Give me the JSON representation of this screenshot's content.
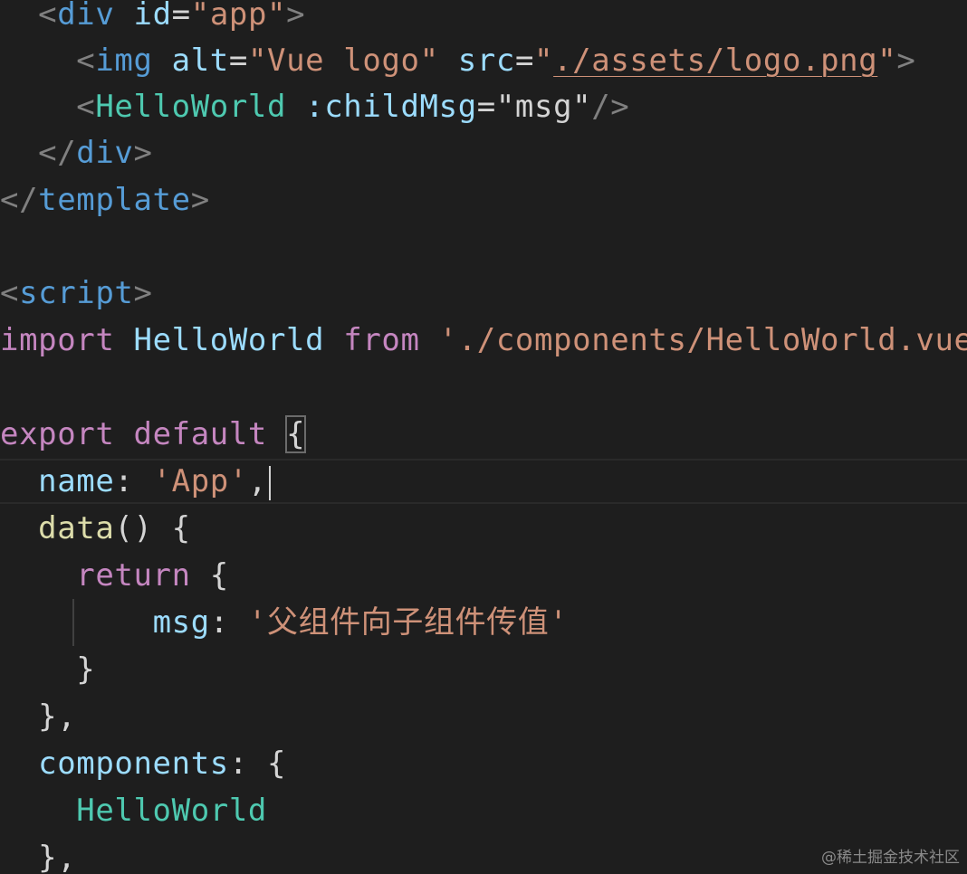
{
  "code": {
    "l1": {
      "lt": "<",
      "tag": "div",
      "attr": "id",
      "eq": "=",
      "q1": "\"",
      "val": "app",
      "q2": "\"",
      "gt": ">"
    },
    "l2": {
      "lt": "<",
      "tag": "img",
      "attr1": "alt",
      "eq1": "=",
      "val1": "\"Vue logo\"",
      "attr2": "src",
      "eq2": "=",
      "q1": "\"",
      "val2": "./assets/logo.png",
      "q2": "\"",
      "gt": ">"
    },
    "l3": {
      "lt": "<",
      "tag": "HelloWorld",
      "attr": ":childMsg",
      "eq": "=",
      "val": "\"msg\"",
      "close": "/>"
    },
    "l4": {
      "lt": "</",
      "tag": "div",
      "gt": ">"
    },
    "l5": {
      "lt": "</",
      "tag": "template",
      "gt": ">"
    },
    "l7": {
      "lt": "<",
      "tag": "script",
      "gt": ">"
    },
    "l8": {
      "kw1": "import",
      "ident": "HelloWorld",
      "kw2": "from",
      "str": "'./components/HelloWorld.vue'"
    },
    "l10": {
      "kw1": "export",
      "kw2": "default",
      "brace": "{"
    },
    "l11": {
      "key": "name",
      "colon": ":",
      "str": "'App'",
      "comma": ","
    },
    "l12": {
      "fn": "data",
      "rest": "() {"
    },
    "l13": {
      "kw": "return",
      "brace": "{"
    },
    "l14": {
      "key": "msg",
      "colon": ":",
      "str": "'父组件向子组件传值'"
    },
    "l15": {
      "brace": "}"
    },
    "l16": {
      "text": "},"
    },
    "l17": {
      "key": "components",
      "colon": ":",
      "brace": "{"
    },
    "l18": {
      "comp": "HelloWorld"
    },
    "l19": {
      "text": "},"
    }
  },
  "watermark": "@稀土掘金技术社区",
  "colors": {
    "background": "#1e1e1e",
    "tag": "#569cd6",
    "component": "#4ec9b0",
    "attribute": "#9cdcfe",
    "string": "#ce9178",
    "keyword": "#c586c0",
    "function": "#dcdcaa",
    "punctuation": "#808080",
    "text": "#d4d4d4"
  }
}
